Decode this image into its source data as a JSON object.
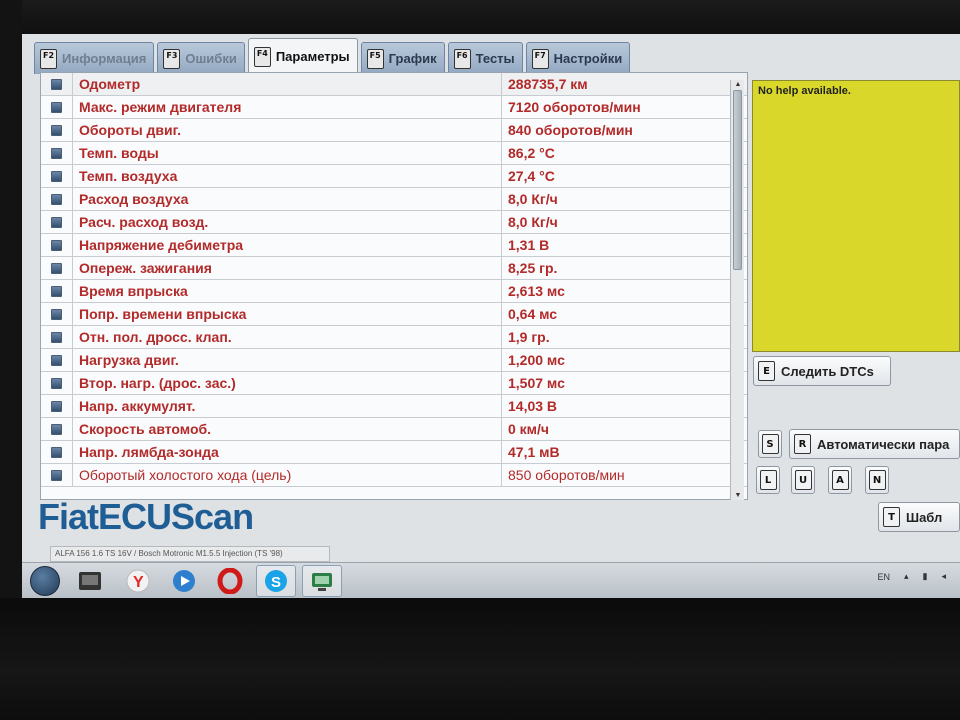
{
  "tabs": [
    {
      "key": "F2",
      "label": "Информация",
      "active": false,
      "dim": true
    },
    {
      "key": "F3",
      "label": "Ошибки",
      "active": false,
      "dim": true
    },
    {
      "key": "F4",
      "label": "Параметры",
      "active": true,
      "dim": false
    },
    {
      "key": "F5",
      "label": "График",
      "active": false,
      "dim": false
    },
    {
      "key": "F6",
      "label": "Тесты",
      "active": false,
      "dim": false
    },
    {
      "key": "F7",
      "label": "Настройки",
      "active": false,
      "dim": false
    }
  ],
  "parameters": [
    {
      "name": "Одометр",
      "value": "288735,7 км"
    },
    {
      "name": "Макс. режим двигателя",
      "value": "7120 оборотов/мин"
    },
    {
      "name": "Обороты двиг.",
      "value": "840 оборотов/мин"
    },
    {
      "name": "Темп. воды",
      "value": "86,2 °C"
    },
    {
      "name": "Темп. воздуха",
      "value": "27,4 °C"
    },
    {
      "name": "Расход воздуха",
      "value": "8,0 Кг/ч"
    },
    {
      "name": "Расч. расход возд.",
      "value": "8,0 Кг/ч"
    },
    {
      "name": "Напряжение дебиметра",
      "value": "1,31 В"
    },
    {
      "name": "Опереж. зажигания",
      "value": "8,25 гр."
    },
    {
      "name": "Время впрыска",
      "value": "2,613 мс"
    },
    {
      "name": "Попр. времени впрыска",
      "value": "0,64 мс"
    },
    {
      "name": "Отн. пол. дросс. клап.",
      "value": "1,9 гр."
    },
    {
      "name": "Нагрузка двиг.",
      "value": "1,200 мс"
    },
    {
      "name": "Втор. нагр. (дрос. зас.)",
      "value": "1,507 мс"
    },
    {
      "name": "Напр. аккумулят.",
      "value": "14,03 В"
    },
    {
      "name": "Скорость автомоб.",
      "value": "0 км/ч"
    },
    {
      "name": "Напр. лямбда-зонда",
      "value": "47,1 мВ"
    },
    {
      "name": "Оборотый холостого хода (цель)",
      "value": "850 оборотов/мин"
    }
  ],
  "help": {
    "text": "No help available."
  },
  "buttons": {
    "track_dtcs": {
      "key": "E",
      "label": "Следить DTCs"
    },
    "s_key": "S",
    "auto": {
      "key": "R",
      "label": "Автоматически пара"
    },
    "small": [
      "L",
      "U",
      "A",
      "N"
    ],
    "template": {
      "key": "T",
      "label": "Шабл"
    }
  },
  "logo": "FiatECUScan",
  "status_text": "ALFA 156 1.6 TS 16V / Bosch Motronic M1.5.5 Injection (TS '98)",
  "tray": {
    "lang": "EN"
  },
  "colors": {
    "value_red": "#b22a2a",
    "help_bg": "#d9d82a",
    "logo_blue": "#1f5e95"
  }
}
